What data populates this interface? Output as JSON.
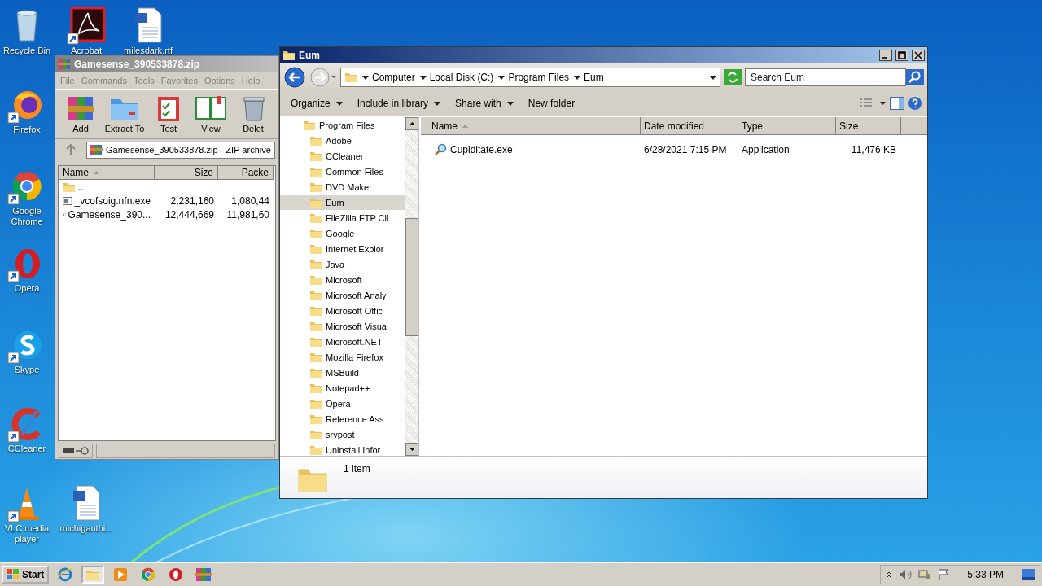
{
  "desktop_icons": [
    {
      "label": "Recycle Bin",
      "kind": "recycle-bin",
      "shortcut": false
    },
    {
      "label": "Firefox",
      "kind": "firefox",
      "shortcut": true
    },
    {
      "label": "Google Chrome",
      "kind": "chrome",
      "shortcut": true
    },
    {
      "label": "Opera",
      "kind": "opera",
      "shortcut": true
    },
    {
      "label": "Skype",
      "kind": "skype",
      "shortcut": true
    },
    {
      "label": "CCleaner",
      "kind": "ccleaner",
      "shortcut": true
    },
    {
      "label": "VLC media player",
      "kind": "vlc",
      "shortcut": true
    },
    {
      "label": "Acrobat",
      "kind": "acrobat",
      "shortcut": true
    },
    {
      "label": "milesdark.rtf",
      "kind": "word-doc",
      "shortcut": false
    },
    {
      "label": "michiganthi...",
      "kind": "word-doc",
      "shortcut": false
    }
  ],
  "winrar": {
    "title": "Gamesense_390533878.zip",
    "menu": [
      "File",
      "Commands",
      "Tools",
      "Favorites",
      "Options",
      "Help"
    ],
    "tools": [
      {
        "label": "Add",
        "kind": "add"
      },
      {
        "label": "Extract To",
        "kind": "extract"
      },
      {
        "label": "Test",
        "kind": "test"
      },
      {
        "label": "View",
        "kind": "view"
      },
      {
        "label": "Delet",
        "kind": "delete"
      }
    ],
    "path": "Gamesense_390533878.zip - ZIP archive",
    "columns": [
      "Name",
      "Size",
      "Packe"
    ],
    "rows": [
      {
        "kind": "parent",
        "name": ".."
      },
      {
        "kind": "file",
        "name": "_vcofsoig.nfn.exe",
        "size": "2,231,160",
        "packed": "1,080,44"
      },
      {
        "kind": "file",
        "name": "Gamesense_390...",
        "size": "12,444,669",
        "packed": "11,981,60"
      }
    ]
  },
  "explorer": {
    "title": "Eum",
    "breadcrumb": [
      "Computer",
      "Local Disk (C:)",
      "Program Files",
      "Eum"
    ],
    "search": {
      "placeholder": "Search Eum"
    },
    "toolbar": [
      {
        "label": "Organize",
        "dropdown": true
      },
      {
        "label": "Include in library",
        "dropdown": true
      },
      {
        "label": "Share with",
        "dropdown": true
      },
      {
        "label": "New folder",
        "dropdown": false
      }
    ],
    "tree": [
      {
        "label": "Program Files",
        "selected": false,
        "children": [
          {
            "label": "Adobe",
            "selected": false
          },
          {
            "label": "CCleaner",
            "selected": false
          },
          {
            "label": "Common Files",
            "selected": false
          },
          {
            "label": "DVD Maker",
            "selected": false
          },
          {
            "label": "Eum",
            "selected": true
          },
          {
            "label": "FileZilla FTP Cli",
            "selected": false
          },
          {
            "label": "Google",
            "selected": false
          },
          {
            "label": "Internet Explor",
            "selected": false
          },
          {
            "label": "Java",
            "selected": false
          },
          {
            "label": "Microsoft",
            "selected": false
          },
          {
            "label": "Microsoft Analy",
            "selected": false
          },
          {
            "label": "Microsoft Offic",
            "selected": false
          },
          {
            "label": "Microsoft Visua",
            "selected": false
          },
          {
            "label": "Microsoft.NET",
            "selected": false
          },
          {
            "label": "Mozilla Firefox",
            "selected": false
          },
          {
            "label": "MSBuild",
            "selected": false
          },
          {
            "label": "Notepad++",
            "selected": false
          },
          {
            "label": "Opera",
            "selected": false
          },
          {
            "label": "Reference Ass",
            "selected": false
          },
          {
            "label": "srvpost",
            "selected": false
          },
          {
            "label": "Uninstall Infor",
            "selected": false
          }
        ]
      }
    ],
    "columns": [
      "Name",
      "Date modified",
      "Type",
      "Size"
    ],
    "files": [
      {
        "name": "Cupiditate.exe",
        "date": "6/28/2021 7:15 PM",
        "type": "Application",
        "size": "11,476 KB"
      }
    ],
    "status": "1 item"
  },
  "taskbar": {
    "start": "Start",
    "apps": [
      {
        "kind": "ie",
        "selected": false
      },
      {
        "kind": "explorer",
        "selected": true
      },
      {
        "kind": "media",
        "selected": false
      },
      {
        "kind": "chrome",
        "selected": false
      },
      {
        "kind": "opera",
        "selected": false
      },
      {
        "kind": "winrar",
        "selected": false
      }
    ],
    "clock": "5:33 PM"
  }
}
